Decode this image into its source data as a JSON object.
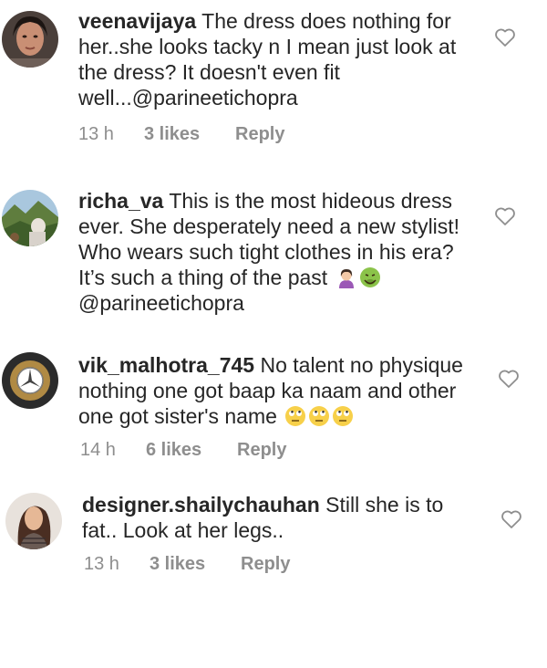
{
  "comments": [
    {
      "username": "veenavijaya",
      "text": " The dress does nothing for her..she looks tacky n I mean just look at the dress? It doesn't even fit well...@parineetichopra",
      "time": "13 h",
      "likes": "3 likes",
      "reply": "Reply",
      "emoji": []
    },
    {
      "username": "richa_va",
      "text": " This is the most hideous dress ever. She desperately need a new stylist! Who wears such tight clothes in his era? It’s such a thing of the past",
      "text_after": "@parineetichopra",
      "emoji": [
        "woman-tipping-hand-emoji",
        "nauseated-face-emoji"
      ]
    },
    {
      "username": "vik_malhotra_745",
      "text": " No talent no physique nothing one got baap ka naam and other one got sister's name",
      "time": "14 h",
      "likes": "6 likes",
      "reply": "Reply",
      "emoji": [
        "eye-roll-emoji",
        "eye-roll-emoji",
        "eye-roll-emoji"
      ]
    },
    {
      "username": "designer.shailychauhan",
      "text": " Still she is to fat.. Look at her legs..",
      "time": "13 h",
      "likes": "3 likes",
      "reply": "Reply",
      "emoji": []
    }
  ],
  "colors": {
    "text": "#262626",
    "meta": "#8e8e8e",
    "heart_stroke": "#8e8e8e"
  },
  "icons": {
    "like": "heart-outline-icon"
  }
}
